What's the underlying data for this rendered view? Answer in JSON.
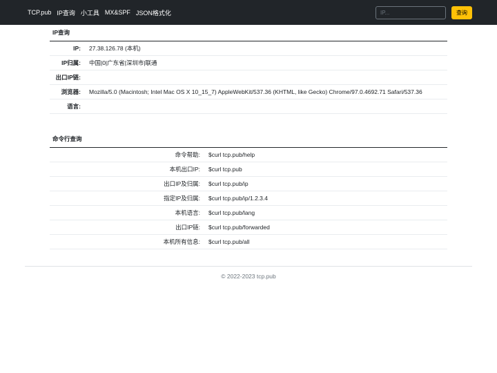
{
  "navbar": {
    "brand": "TCP.pub",
    "links": [
      "IP查询",
      "小工具",
      "MX&SPF",
      "JSON格式化"
    ],
    "search_placeholder": "IP...",
    "search_button": "查询"
  },
  "ip_section": {
    "title": "IP查询",
    "rows": [
      {
        "label": "IP:",
        "value": "27.38.126.78 (本机)"
      },
      {
        "label": "IP归属:",
        "value": "中国|0|广东省|深圳市|联通"
      },
      {
        "label": "出口IP链:",
        "value": ""
      },
      {
        "label": "浏览器:",
        "value": "Mozilla/5.0 (Macintosh; Intel Mac OS X 10_15_7) AppleWebKit/537.36 (KHTML, like Gecko) Chrome/97.0.4692.71 Safari/537.36"
      },
      {
        "label": "语言:",
        "value": ""
      }
    ]
  },
  "cmd_section": {
    "title": "命令行查询",
    "rows": [
      {
        "label": "命令帮助:",
        "value": "$curl tcp.pub/help"
      },
      {
        "label": "本机出口IP:",
        "value": "$curl tcp.pub"
      },
      {
        "label": "出口IP及归属:",
        "value": "$curl tcp.pub/ip"
      },
      {
        "label": "指定IP及归属:",
        "value": "$curl tcp.pub/ip/1.2.3.4"
      },
      {
        "label": "本机语言:",
        "value": "$curl tcp.pub/lang"
      },
      {
        "label": "出口IP链:",
        "value": "$curl tcp.pub/forwarded"
      },
      {
        "label": "本机所有信息:",
        "value": "$curl tcp.pub/all"
      }
    ]
  },
  "footer": {
    "copyright": "© 2022-2023 tcp.pub"
  }
}
